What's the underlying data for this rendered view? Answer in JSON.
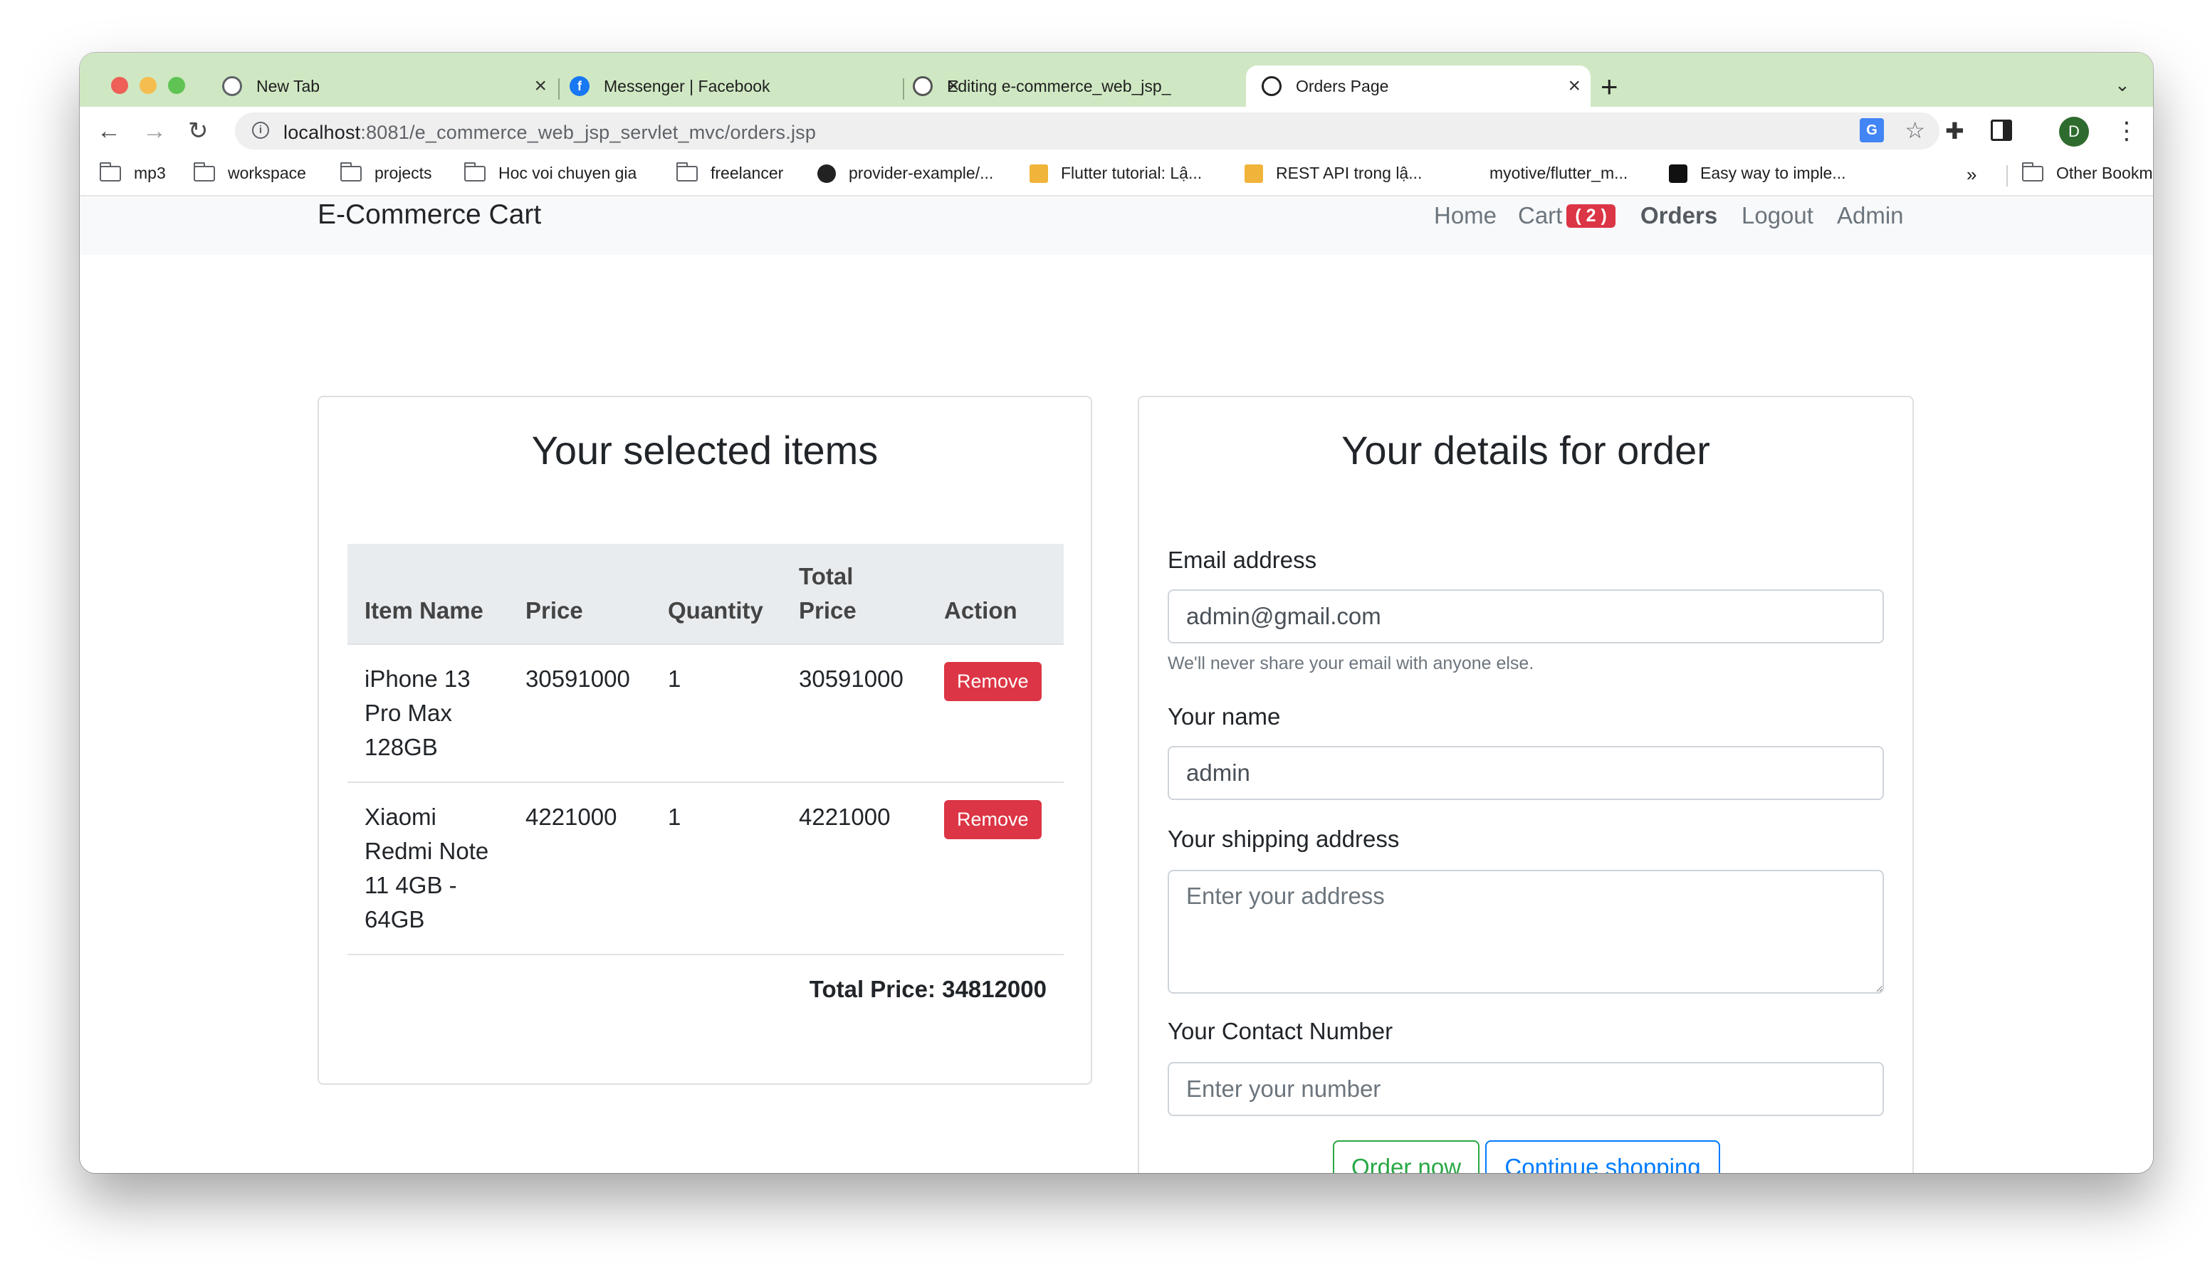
{
  "browser": {
    "tabs": [
      {
        "title": "New Tab"
      },
      {
        "title": "Messenger | Facebook"
      },
      {
        "title": "Editing e-commerce_web_jsp_"
      },
      {
        "title": "Orders Page"
      }
    ],
    "url_host": "localhost",
    "url_path": ":8081/e_commerce_web_jsp_servlet_mvc/orders.jsp",
    "profile_initial": "D",
    "bookmarks": [
      "mp3",
      "workspace",
      "projects",
      "Hoc voi chuyen gia",
      "freelancer",
      "provider-example/...",
      "Flutter tutorial: Lậ...",
      "REST API trong lậ...",
      "myotive/flutter_m...",
      "Easy way to imple..."
    ],
    "more_bookmarks": "»",
    "other_bookmarks": "Other Bookmarks"
  },
  "navbar": {
    "brand": "E-Commerce Cart",
    "home": "Home",
    "cart": "Cart",
    "cart_count": "( 2 )",
    "orders": "Orders",
    "logout": "Logout",
    "admin": "Admin"
  },
  "items_card": {
    "title": "Your selected items",
    "headers": [
      "Item Name",
      "Price",
      "Quantity",
      "Total Price",
      "Action"
    ],
    "rows": [
      {
        "name": "iPhone 13 Pro Max 128GB",
        "price": "30591000",
        "quantity": "1",
        "total": "30591000",
        "action": "Remove"
      },
      {
        "name": "Xiaomi Redmi Note 11 4GB - 64GB",
        "price": "4221000",
        "quantity": "1",
        "total": "4221000",
        "action": "Remove"
      }
    ],
    "total_label": "Total Price: 34812000"
  },
  "order_form": {
    "title": "Your details for order",
    "email_label": "Email address",
    "email_value": "admin@gmail.com",
    "email_help": "We'll never share your email with anyone else.",
    "name_label": "Your name",
    "name_value": "admin",
    "address_label": "Your shipping address",
    "address_placeholder": "Enter your address",
    "contact_label": "Your Contact Number",
    "contact_placeholder": "Enter your number",
    "order_button": "Order now",
    "continue_button": "Continue shopping"
  }
}
